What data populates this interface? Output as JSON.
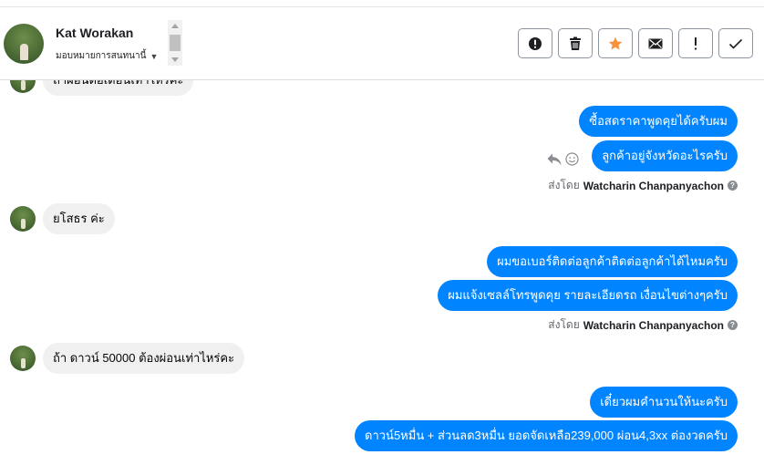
{
  "header": {
    "contact_name": "Kat Worakan",
    "assign_label": "มอบหมายการสนทนานี้",
    "actions": [
      {
        "icon": "exclamation-circle-icon",
        "label": "Spam"
      },
      {
        "icon": "trash-icon",
        "label": "Delete"
      },
      {
        "icon": "star-icon",
        "label": "Star",
        "color": "#f7923a"
      },
      {
        "icon": "envelope-icon",
        "label": "Mark unread"
      },
      {
        "icon": "exclamation-icon",
        "label": "Follow up"
      },
      {
        "icon": "check-icon",
        "label": "Done"
      }
    ]
  },
  "messages": {
    "top_partial": "ถ้าผ่อนต่อเดือนเท่าไหร่คะ",
    "out1": "ซื้อสดราคาพูดคุยได้ครับผม",
    "out2": "ลูกค้าอยู่จังหวัดอะไรครับ",
    "in1": "ยโสธร ค่ะ",
    "out3": "ผมขอเบอร์ติดต่อลูกค้าติดต่อลูกค้าได้ไหมครับ",
    "out4": "ผมแจ้งเซลล์โทรพูดคุย รายละเอียดรถ เงื่อนไขต่างๆครับ",
    "in2": "ถ้า ดาวน์ 50000 ต้องผ่อนเท่าไหร่คะ",
    "out5": "เดี๋ยวผมคำนวนให้นะครับ",
    "out6": "ดาวน์5หมื่น + ส่วนลด3หมื่น ยอดจัดเหลือ239,000 ผ่อน4,3xx ต่องวดครับ"
  },
  "sent_by": {
    "prefix": "ส่งโดย",
    "name": "Watcharin Chanpanyachon"
  },
  "colors": {
    "outgoing_bubble": "#0084ff",
    "incoming_bubble": "#f0f0f0",
    "star": "#f7923a"
  }
}
